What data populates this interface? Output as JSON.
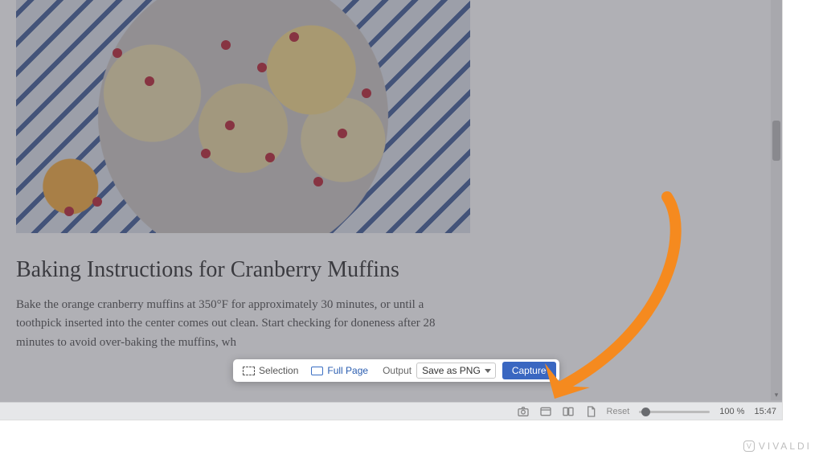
{
  "article": {
    "title": "Baking Instructions for Cranberry Muffins",
    "body": "Bake the orange cranberry muffins at 350°F for approximately 30 minutes, or until a toothpick inserted into the center comes out clean. Start checking for doneness after 28 minutes to avoid over-baking the muffins, wh"
  },
  "capture_bar": {
    "selection_label": "Selection",
    "fullpage_label": "Full Page",
    "output_label": "Output",
    "output_value": "Save as PNG",
    "capture_label": "Capture"
  },
  "statusbar": {
    "reset_label": "Reset",
    "zoom_value": "100 %",
    "clock": "15:47"
  },
  "brand": "VIVALDI",
  "icons": {
    "capture": "capture-icon",
    "panel": "panel-icon",
    "tiling": "tiling-icon",
    "images": "images-icon"
  },
  "annotation": {
    "color": "#f58a1f"
  }
}
